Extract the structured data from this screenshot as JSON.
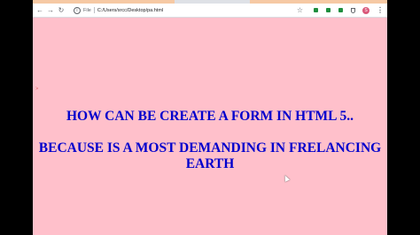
{
  "browser": {
    "scheme_label": "File",
    "url": "C:/Users/srcc/Desktop/pa.html",
    "avatar_letter": "S",
    "icons": {
      "back": "arrow-left-icon",
      "forward": "arrow-right-icon",
      "reload": "reload-icon",
      "info": "info-icon",
      "star": "star-icon",
      "extension": "extension-icon",
      "shield": "shield-icon",
      "menu": "kebab-menu-icon"
    }
  },
  "page": {
    "marker": ">",
    "heading_1": "HOW CAN BE CREATE A FORM IN HTML 5..",
    "heading_2": "BECAUSE IS A MOST DEMANDING IN FRELANCING EARTH"
  },
  "colors": {
    "page_background": "#ffc0cb",
    "heading_text": "#0000cd",
    "marker_text": "#d01010",
    "avatar": "#d9587a",
    "extension": "#1e8e3e"
  }
}
